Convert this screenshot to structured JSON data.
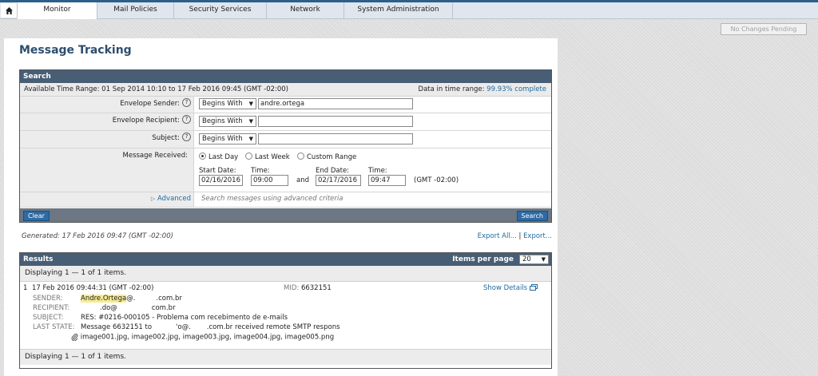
{
  "nav": {
    "tabs": [
      "Monitor",
      "Mail Policies",
      "Security Services",
      "Network",
      "System Administration"
    ],
    "pending": "No Changes Pending"
  },
  "page": {
    "title": "Message Tracking"
  },
  "search": {
    "header": "Search",
    "available_range": "Available Time Range: 01 Sep 2014 10:10 to 17 Feb 2016 09:45 (GMT -02:00)",
    "data_in_range_label": "Data in time range:",
    "data_in_range_value": "99.93% complete",
    "envelope_sender": {
      "label": "Envelope Sender:",
      "operator": "Begins With",
      "value": "andre.ortega"
    },
    "envelope_recipient": {
      "label": "Envelope Recipient:",
      "operator": "Begins With",
      "value": ""
    },
    "subject": {
      "label": "Subject:",
      "operator": "Begins With",
      "value": ""
    },
    "message_received": {
      "label": "Message Received:",
      "options": [
        "Last Day",
        "Last Week",
        "Custom Range"
      ],
      "selected": "Last Day",
      "start_date_label": "Start Date:",
      "start_date": "02/16/2016",
      "start_time_label": "Time:",
      "start_time": "09:00",
      "and_label": "and",
      "end_date_label": "End Date:",
      "end_date": "02/17/2016",
      "end_time_label": "Time:",
      "end_time": "09:47",
      "tz": "(GMT -02:00)"
    },
    "advanced_label": "Advanced",
    "advanced_hint": "Search messages using advanced criteria",
    "clear_label": "Clear",
    "search_label": "Search"
  },
  "generated": "Generated: 17 Feb 2016 09:47 (GMT -02:00)",
  "export_all": "Export All...",
  "export_sep": "|",
  "export": "Export...",
  "results": {
    "header": "Results",
    "items_per_page_label": "Items per page",
    "items_per_page": "20",
    "displaying_top": "Displaying 1 — 1 of 1 items.",
    "displaying_bottom": "Displaying 1 — 1 of 1 items.",
    "row": {
      "index": "1",
      "timestamp": "17 Feb 2016 09:44:31 (GMT -02:00)",
      "mid_label": "MID:",
      "mid": "6632151",
      "show_details": "Show Details",
      "sender_label": "SENDER:",
      "sender_name": "Andre.Ortega",
      "sender_at": "@.",
      "sender_domain": ".com.br",
      "recipient_label": "RECIPIENT:",
      "recipient_local": ".do@",
      "recipient_domain": "com.br",
      "subject_label": "SUBJECT:",
      "subject": "RES: #0216-000105 - Problema com recebimento de e-mails",
      "last_state_label": "LAST STATE:",
      "last_state_a": "Message 6632151 to",
      "last_state_b": "'o@.",
      "last_state_c": ".com.br received remote SMTP respons",
      "attachments": "image001.jpg, image002.jpg, image003.jpg, image004.jpg, image005.png"
    }
  }
}
